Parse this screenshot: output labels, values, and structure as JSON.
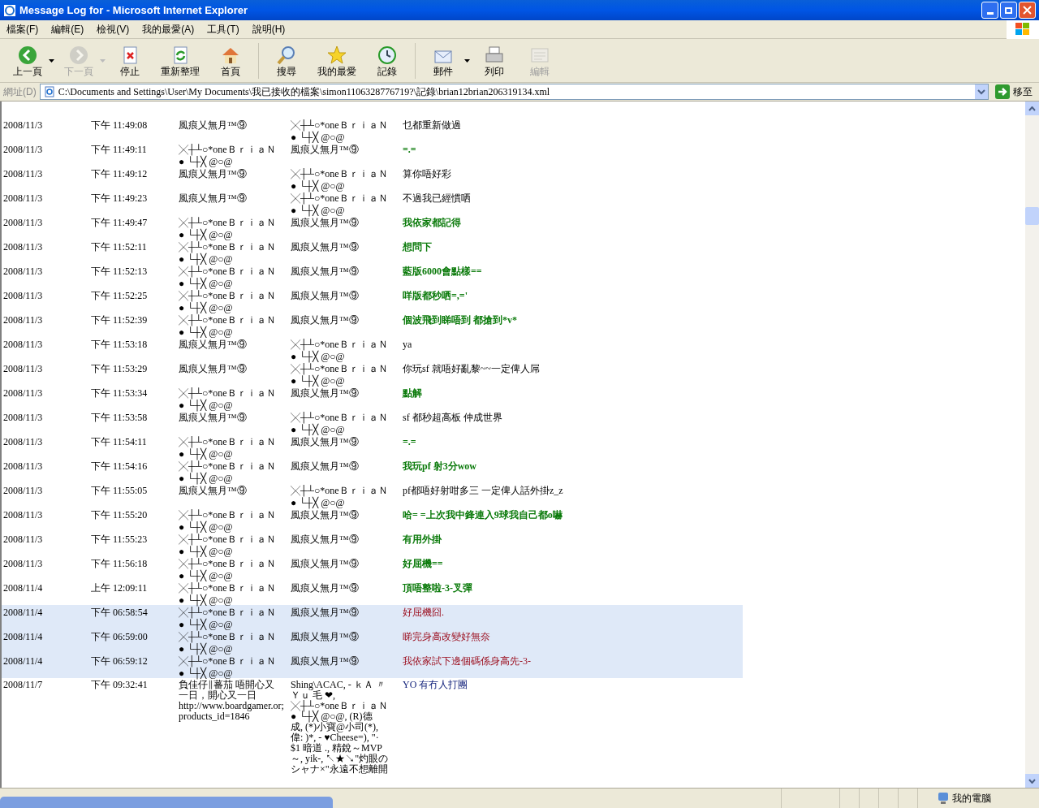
{
  "window": {
    "title": "Message Log for - Microsoft Internet Explorer"
  },
  "menu": [
    "檔案(F)",
    "編輯(E)",
    "檢視(V)",
    "我的最愛(A)",
    "工具(T)",
    "說明(H)"
  ],
  "toolbar": [
    {
      "kind": "back",
      "label": "上一頁",
      "disabled": false,
      "dropdown": true
    },
    {
      "kind": "forward",
      "label": "下一頁",
      "disabled": true,
      "dropdown": true
    },
    {
      "kind": "stop",
      "label": "停止",
      "disabled": false,
      "dropdown": false
    },
    {
      "kind": "refresh",
      "label": "重新整理",
      "disabled": false,
      "dropdown": false
    },
    {
      "kind": "home",
      "label": "首頁",
      "disabled": false,
      "dropdown": false
    },
    {
      "kind": "separator"
    },
    {
      "kind": "search",
      "label": "搜尋",
      "disabled": false,
      "dropdown": false
    },
    {
      "kind": "favorites",
      "label": "我的最愛",
      "disabled": false,
      "dropdown": false
    },
    {
      "kind": "history",
      "label": "記錄",
      "disabled": false,
      "dropdown": false
    },
    {
      "kind": "separator"
    },
    {
      "kind": "mail",
      "label": "郵件",
      "disabled": false,
      "dropdown": true
    },
    {
      "kind": "print",
      "label": "列印",
      "disabled": false,
      "dropdown": false
    },
    {
      "kind": "edit",
      "label": "編輯",
      "disabled": true,
      "dropdown": false
    }
  ],
  "address_bar": {
    "label": "網址(D)",
    "value": "C:\\Documents and Settings\\User\\My Documents\\我已接收的檔案\\simon1106328776719?\\記錄\\brian12brian206319134.xml",
    "go": "移至"
  },
  "log_rows": [
    {
      "date": "2008/11/3",
      "time": "下午 11:49:08",
      "from": [
        "風痕乂無月™⑨"
      ],
      "to": [
        "╳┼┴○*oneＢｒｉａＮ",
        "● └┼╳ @○@"
      ],
      "message": "乜都重新做過",
      "kind": "plain",
      "highlighted": false
    },
    {
      "date": "2008/11/3",
      "time": "下午 11:49:11",
      "from": [
        "╳┼┴○*oneＢｒｉａＮ",
        "● └┼╳ @○@"
      ],
      "to": [
        "風痕乂無月™⑨"
      ],
      "message": "=.=",
      "kind": "green",
      "highlighted": false
    },
    {
      "date": "2008/11/3",
      "time": "下午 11:49:12",
      "from": [
        "風痕乂無月™⑨"
      ],
      "to": [
        "╳┼┴○*oneＢｒｉａＮ",
        "● └┼╳ @○@"
      ],
      "message": "算你唔好彩",
      "kind": "plain",
      "highlighted": false
    },
    {
      "date": "2008/11/3",
      "time": "下午 11:49:23",
      "from": [
        "風痕乂無月™⑨"
      ],
      "to": [
        "╳┼┴○*oneＢｒｉａＮ",
        "● └┼╳ @○@"
      ],
      "message": "不過我已經慣哂",
      "kind": "plain",
      "highlighted": false
    },
    {
      "date": "2008/11/3",
      "time": "下午 11:49:47",
      "from": [
        "╳┼┴○*oneＢｒｉａＮ",
        "● └┼╳ @○@"
      ],
      "to": [
        "風痕乂無月™⑨"
      ],
      "message": "我依家都記得",
      "kind": "green",
      "highlighted": false
    },
    {
      "date": "2008/11/3",
      "time": "下午 11:52:11",
      "from": [
        "╳┼┴○*oneＢｒｉａＮ",
        "● └┼╳ @○@"
      ],
      "to": [
        "風痕乂無月™⑨"
      ],
      "message": "想問下",
      "kind": "green",
      "highlighted": false
    },
    {
      "date": "2008/11/3",
      "time": "下午 11:52:13",
      "from": [
        "╳┼┴○*oneＢｒｉａＮ",
        "● └┼╳ @○@"
      ],
      "to": [
        "風痕乂無月™⑨"
      ],
      "message": "藍版6000會點樣==",
      "kind": "green",
      "highlighted": false
    },
    {
      "date": "2008/11/3",
      "time": "下午 11:52:25",
      "from": [
        "╳┼┴○*oneＢｒｉａＮ",
        "● └┼╳ @○@"
      ],
      "to": [
        "風痕乂無月™⑨"
      ],
      "message": "咩版都秒哂=,='",
      "kind": "green",
      "highlighted": false
    },
    {
      "date": "2008/11/3",
      "time": "下午 11:52:39",
      "from": [
        "╳┼┴○*oneＢｒｉａＮ",
        "● └┼╳ @○@"
      ],
      "to": [
        "風痕乂無月™⑨"
      ],
      "message": "個波飛到睇唔到 都搶到*v*",
      "kind": "green",
      "highlighted": false
    },
    {
      "date": "2008/11/3",
      "time": "下午 11:53:18",
      "from": [
        "風痕乂無月™⑨"
      ],
      "to": [
        "╳┼┴○*oneＢｒｉａＮ",
        "● └┼╳ @○@"
      ],
      "message": "ya",
      "kind": "plain",
      "highlighted": false
    },
    {
      "date": "2008/11/3",
      "time": "下午 11:53:29",
      "from": [
        "風痕乂無月™⑨"
      ],
      "to": [
        "╳┼┴○*oneＢｒｉａＮ",
        "● └┼╳ @○@"
      ],
      "message": "你玩sf 就唔好亂黎~~一定俾人屌",
      "kind": "plain",
      "highlighted": false
    },
    {
      "date": "2008/11/3",
      "time": "下午 11:53:34",
      "from": [
        "╳┼┴○*oneＢｒｉａＮ",
        "● └┼╳ @○@"
      ],
      "to": [
        "風痕乂無月™⑨"
      ],
      "message": "點解",
      "kind": "green",
      "highlighted": false
    },
    {
      "date": "2008/11/3",
      "time": "下午 11:53:58",
      "from": [
        "風痕乂無月™⑨"
      ],
      "to": [
        "╳┼┴○*oneＢｒｉａＮ",
        "● └┼╳ @○@"
      ],
      "message": "sf 都秒超高板 仲成世界",
      "kind": "plain",
      "highlighted": false
    },
    {
      "date": "2008/11/3",
      "time": "下午 11:54:11",
      "from": [
        "╳┼┴○*oneＢｒｉａＮ",
        "● └┼╳ @○@"
      ],
      "to": [
        "風痕乂無月™⑨"
      ],
      "message": "=.=",
      "kind": "green",
      "highlighted": false
    },
    {
      "date": "2008/11/3",
      "time": "下午 11:54:16",
      "from": [
        "╳┼┴○*oneＢｒｉａＮ",
        "● └┼╳ @○@"
      ],
      "to": [
        "風痕乂無月™⑨"
      ],
      "message": "我玩pf 射3分wow",
      "kind": "green",
      "highlighted": false
    },
    {
      "date": "2008/11/3",
      "time": "下午 11:55:05",
      "from": [
        "風痕乂無月™⑨"
      ],
      "to": [
        "╳┼┴○*oneＢｒｉａＮ",
        "● └┼╳ @○@"
      ],
      "message": "pf都唔好射咁多三 一定俾人話外掛z_z",
      "kind": "plain",
      "highlighted": false
    },
    {
      "date": "2008/11/3",
      "time": "下午 11:55:20",
      "from": [
        "╳┼┴○*oneＢｒｉａＮ",
        "● └┼╳ @○@"
      ],
      "to": [
        "風痕乂無月™⑨"
      ],
      "message": "哈= =上次我中鋒連入9球我自己都o嚇",
      "kind": "green",
      "highlighted": false
    },
    {
      "date": "2008/11/3",
      "time": "下午 11:55:23",
      "from": [
        "╳┼┴○*oneＢｒｉａＮ",
        "● └┼╳ @○@"
      ],
      "to": [
        "風痕乂無月™⑨"
      ],
      "message": "有用外掛",
      "kind": "green",
      "highlighted": false
    },
    {
      "date": "2008/11/3",
      "time": "下午 11:56:18",
      "from": [
        "╳┼┴○*oneＢｒｉａＮ",
        "● └┼╳ @○@"
      ],
      "to": [
        "風痕乂無月™⑨"
      ],
      "message": "好屈機==",
      "kind": "green",
      "highlighted": false
    },
    {
      "date": "2008/11/4",
      "time": "上午 12:09:11",
      "from": [
        "╳┼┴○*oneＢｒｉａＮ",
        "● └┼╳ @○@"
      ],
      "to": [
        "風痕乂無月™⑨"
      ],
      "message": "頂唔整啦-3-叉彈",
      "kind": "green",
      "highlighted": false
    },
    {
      "date": "2008/11/4",
      "time": "下午 06:58:54",
      "from": [
        "╳┼┴○*oneＢｒｉａＮ",
        "● └┼╳ @○@"
      ],
      "to": [
        "風痕乂無月™⑨"
      ],
      "message": "好屈機囧.",
      "kind": "red",
      "highlighted": true
    },
    {
      "date": "2008/11/4",
      "time": "下午 06:59:00",
      "from": [
        "╳┼┴○*oneＢｒｉａＮ",
        "● └┼╳ @○@"
      ],
      "to": [
        "風痕乂無月™⑨"
      ],
      "message": "睇完身高改變好無奈",
      "kind": "red",
      "highlighted": true
    },
    {
      "date": "2008/11/4",
      "time": "下午 06:59:12",
      "from": [
        "╳┼┴○*oneＢｒｉａＮ",
        "● └┼╳ @○@"
      ],
      "to": [
        "風痕乂無月™⑨"
      ],
      "message": "我依家試下邊個碼係身高先-3-",
      "kind": "red",
      "highlighted": true
    },
    {
      "date": "2008/11/7",
      "time": "下午 09:32:41",
      "from": [
        "負佳仔∥蕃茄 唔開心又",
        "一日，開心又一日",
        "http://www.boardgamer.or;",
        "products_id=1846"
      ],
      "to": [
        "Shing\\ACAC, - ｋＡ 〃",
        "Ｙｕ 毛 ❤,",
        "╳┼┴○*oneＢｒｉａＮ",
        "● └┼╳ @○@, (R)德",
        "成, (*)小寶@小司(*),",
        "偉: )*, - ♥Cheese=), \"·",
        "$1 暗道 ., 精銳～MVP",
        "～, yik-, ↖★↘\"灼眼の",
        "シャナ×\"永遠不想離開"
      ],
      "message": "YO 有冇人打團",
      "kind": "blue",
      "highlighted": false
    }
  ],
  "status_bar": {
    "zone": "我的電腦"
  }
}
